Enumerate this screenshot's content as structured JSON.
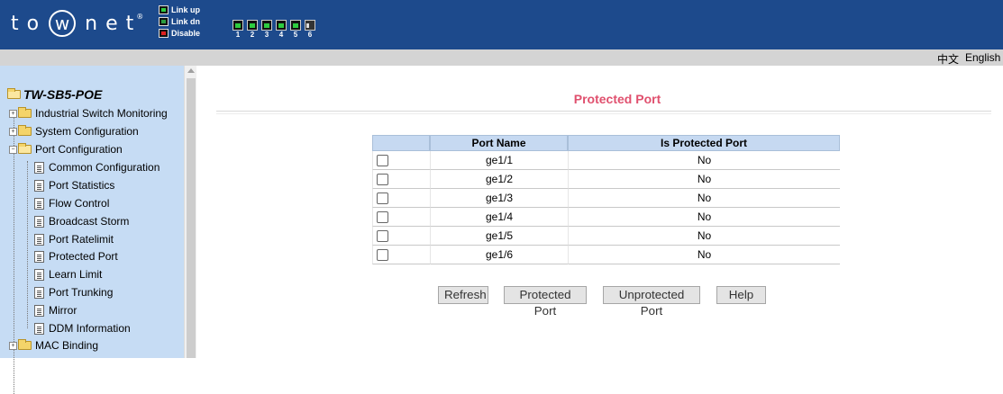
{
  "brand": {
    "logo_text": "towonet",
    "logo_parts": [
      "t",
      "o",
      "w",
      "n",
      "e",
      "t"
    ],
    "reg": "®"
  },
  "legend": [
    {
      "label": "Link up",
      "color": "#2ecc40"
    },
    {
      "label": "Link dn",
      "color": "#2a9d40"
    },
    {
      "label": "Disable",
      "color": "#e02020"
    }
  ],
  "ports": [
    "1",
    "2",
    "3",
    "4",
    "5",
    "6"
  ],
  "language": {
    "chinese": "中文",
    "english": "English"
  },
  "sidebar": {
    "root": "TW-SB5-POE",
    "items": [
      {
        "label": "Industrial Switch Monitoring",
        "type": "folder"
      },
      {
        "label": "System Configuration",
        "type": "folder"
      },
      {
        "label": "Port Configuration",
        "type": "folder-open"
      },
      {
        "label": "Common Configuration",
        "type": "doc"
      },
      {
        "label": "Port Statistics",
        "type": "doc"
      },
      {
        "label": "Flow Control",
        "type": "doc"
      },
      {
        "label": "Broadcast Storm",
        "type": "doc"
      },
      {
        "label": "Port Ratelimit",
        "type": "doc"
      },
      {
        "label": "Protected Port",
        "type": "doc"
      },
      {
        "label": "Learn Limit",
        "type": "doc"
      },
      {
        "label": "Port Trunking",
        "type": "doc"
      },
      {
        "label": "Mirror",
        "type": "doc"
      },
      {
        "label": "DDM Information",
        "type": "doc"
      },
      {
        "label": "MAC Binding",
        "type": "folder"
      }
    ]
  },
  "main": {
    "title": "Protected Port",
    "table": {
      "headers": [
        "",
        "Port Name",
        "Is Protected Port"
      ],
      "rows": [
        {
          "port": "ge1/1",
          "protected": "No"
        },
        {
          "port": "ge1/2",
          "protected": "No"
        },
        {
          "port": "ge1/3",
          "protected": "No"
        },
        {
          "port": "ge1/4",
          "protected": "No"
        },
        {
          "port": "ge1/5",
          "protected": "No"
        },
        {
          "port": "ge1/6",
          "protected": "No"
        }
      ]
    },
    "buttons": {
      "refresh": "Refresh",
      "protected": "Protected Port",
      "unprotected": "Unprotected Port",
      "help": "Help"
    }
  }
}
